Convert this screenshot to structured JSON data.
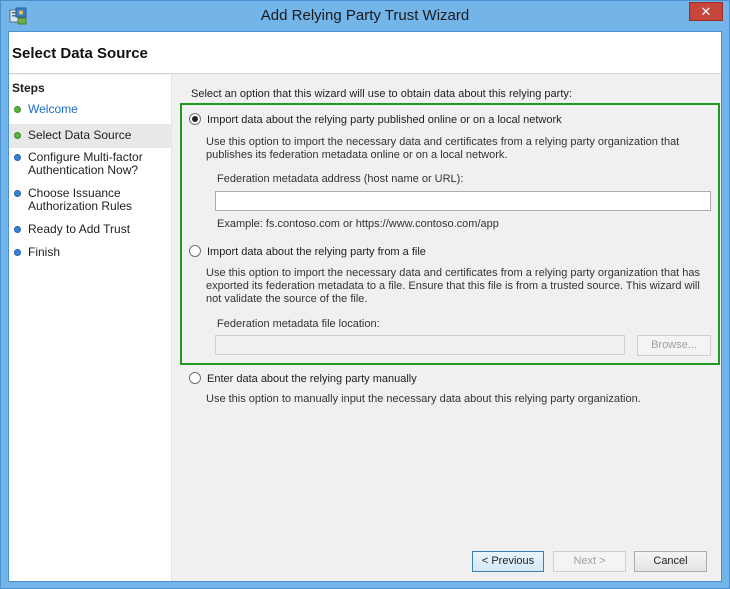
{
  "window": {
    "title": "Add Relying Party Trust Wizard",
    "close_label": "✕"
  },
  "header": {
    "title": "Select Data Source"
  },
  "steps": {
    "title": "Steps",
    "items": [
      {
        "label": "Welcome",
        "status": "done"
      },
      {
        "label": "Select Data Source",
        "status": "current"
      },
      {
        "label": "Configure Multi-factor Authentication Now?",
        "status": "pending"
      },
      {
        "label": "Choose Issuance Authorization Rules",
        "status": "pending"
      },
      {
        "label": "Ready to Add Trust",
        "status": "pending"
      },
      {
        "label": "Finish",
        "status": "pending"
      }
    ]
  },
  "content": {
    "intro": "Select an option that this wizard will use to obtain data about this relying party:",
    "option_online": {
      "label": "Import data about the relying party published online or on a local network",
      "selected": true,
      "description": "Use this option to import the necessary data and certificates from a relying party organization that publishes its federation metadata online or on a local network.",
      "field_label": "Federation metadata address (host name or URL):",
      "field_value": "",
      "example": "Example: fs.contoso.com or https://www.contoso.com/app"
    },
    "option_file": {
      "label": "Import data about the relying party from a file",
      "selected": false,
      "description": "Use this option to import the necessary data and certificates from a relying party organization that has exported its federation metadata to a file. Ensure that this file is from a trusted source.  This wizard will not validate the source of the file.",
      "field_label": "Federation metadata file location:",
      "field_value": "",
      "browse_label": "Browse..."
    },
    "option_manual": {
      "label": "Enter data about the relying party manually",
      "selected": false,
      "description": "Use this option to manually input the necessary data about this relying party organization."
    }
  },
  "footer": {
    "previous_label": "< Previous",
    "next_label": "Next >",
    "cancel_label": "Cancel"
  },
  "colors": {
    "titlebar": "#73b4e9",
    "highlight_border": "#1f9a1f",
    "close_button": "#c7463c",
    "done_dot": "#58b341",
    "pending_dot": "#3b82d8"
  }
}
